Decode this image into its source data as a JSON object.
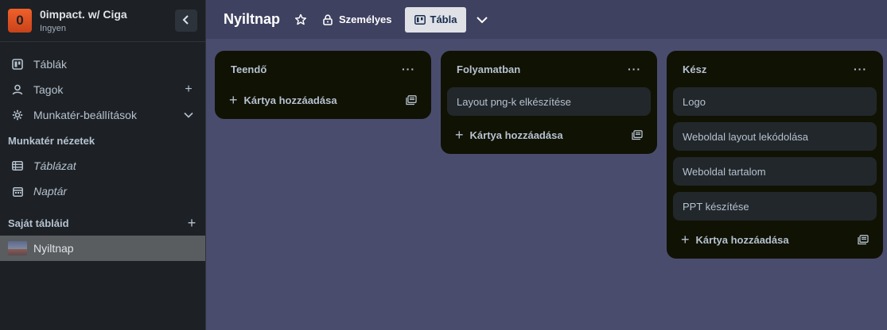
{
  "workspace": {
    "logo_letter": "0",
    "name": "0impact. w/ Ciga",
    "plan": "Ingyen",
    "collapse_icon": "chevron-left-icon"
  },
  "sidebar": {
    "items": [
      {
        "label": "Táblák",
        "icon": "board-icon"
      },
      {
        "label": "Tagok",
        "icon": "person-icon",
        "trail": "+"
      },
      {
        "label": "Munkatér-beállítások",
        "icon": "gear-icon",
        "trail": "chevron-down"
      }
    ],
    "views_title": "Munkatér nézetek",
    "views": [
      {
        "label": "Táblázat",
        "icon": "table-icon"
      },
      {
        "label": "Naptár",
        "icon": "calendar-icon"
      }
    ],
    "boards_title": "Saját tábláid",
    "boards_add": "+",
    "boards": [
      {
        "label": "Nyiltnap"
      }
    ]
  },
  "header": {
    "title": "Nyiltnap",
    "visibility_label": "Személyes",
    "view_label": "Tábla"
  },
  "lists": [
    {
      "title": "Teendő",
      "menu": "···",
      "cards": [],
      "add_label": "Kártya hozzáadása"
    },
    {
      "title": "Folyamatban",
      "menu": "···",
      "cards": [
        "Layout png-k elkészítése"
      ],
      "add_label": "Kártya hozzáadása"
    },
    {
      "title": "Kész",
      "menu": "···",
      "cards": [
        "Logo",
        "Weboldal layout lekódolása",
        "Weboldal tartalom",
        "PPT készítése"
      ],
      "add_label": "Kártya hozzáadása"
    }
  ],
  "colors": {
    "sidebar_bg": "#1d2125",
    "board_bg": "#4a4c6e",
    "list_bg": "#101204",
    "card_bg": "#22272b",
    "logo_accent": "#e0532a"
  }
}
